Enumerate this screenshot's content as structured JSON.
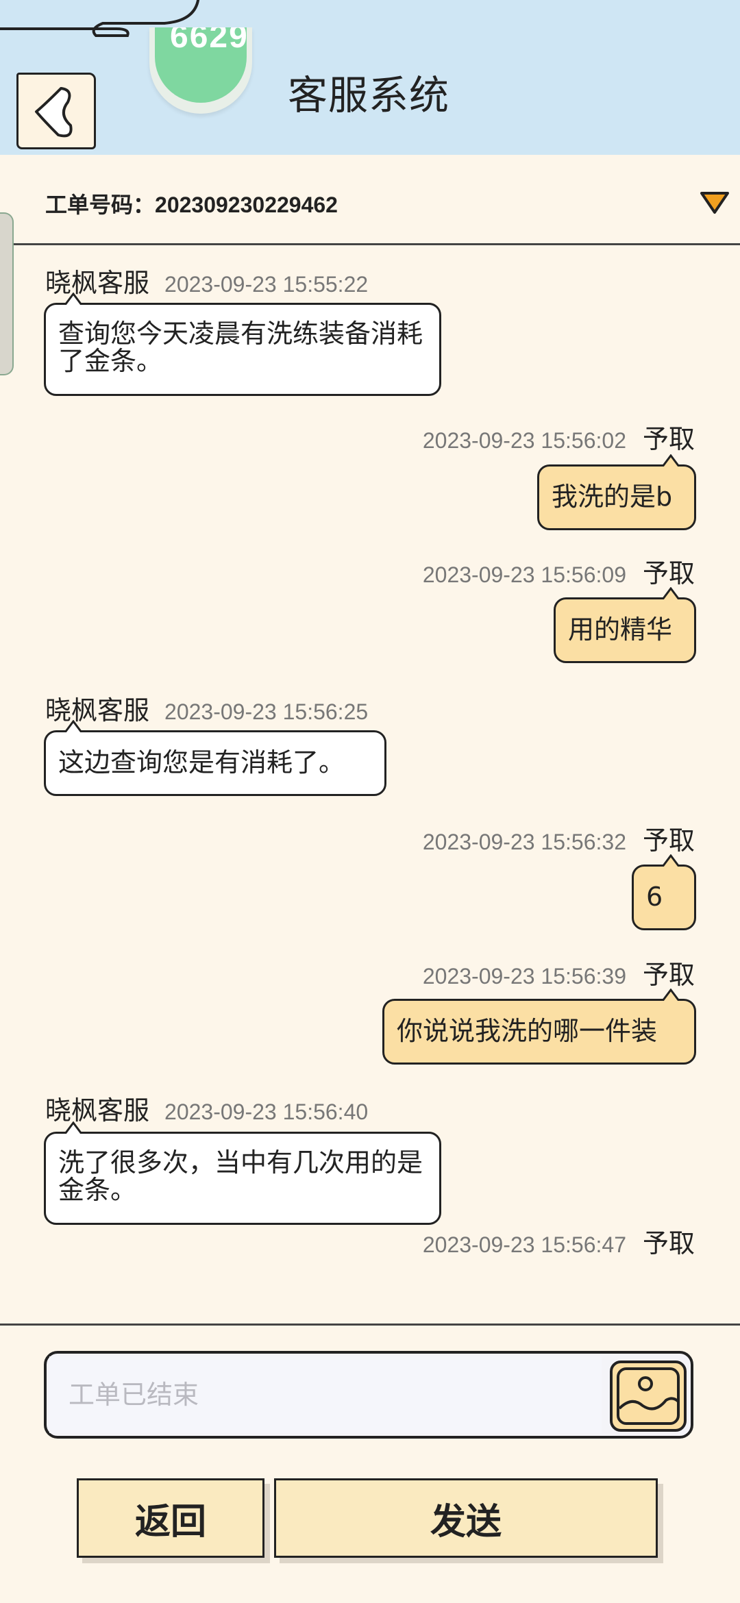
{
  "header": {
    "title": "客服系统",
    "avatar_text": "6629"
  },
  "ticket": {
    "label": "工单号码：",
    "number": "202309230229462"
  },
  "messages": [
    {
      "side": "left",
      "sender": "晓枫客服",
      "time": "2023-09-23 15:55:22",
      "text": "查询您今天凌晨有洗练装备消耗了金条。"
    },
    {
      "side": "right",
      "sender": "予取",
      "time": "2023-09-23 15:56:02",
      "text": "我洗的是b"
    },
    {
      "side": "right",
      "sender": "予取",
      "time": "2023-09-23 15:56:09",
      "text": "用的精华"
    },
    {
      "side": "left",
      "sender": "晓枫客服",
      "time": "2023-09-23 15:56:25",
      "text": "这边查询您是有消耗了。"
    },
    {
      "side": "right",
      "sender": "予取",
      "time": "2023-09-23 15:56:32",
      "text": "6"
    },
    {
      "side": "right",
      "sender": "予取",
      "time": "2023-09-23 15:56:39",
      "text": "你说说我洗的哪一件装"
    },
    {
      "side": "left",
      "sender": "晓枫客服",
      "time": "2023-09-23 15:56:40",
      "text": "洗了很多次，当中有几次用的是金条。"
    },
    {
      "side": "right",
      "sender": "予取",
      "time": "2023-09-23 15:56:47",
      "text": ""
    }
  ],
  "input": {
    "placeholder": "工单已结束"
  },
  "buttons": {
    "back": "返回",
    "send": "发送"
  },
  "colors": {
    "header_bg": "#cfe6f4",
    "page_bg": "#fdf6ea",
    "bubble_mine": "#fbdfa4",
    "bubble_other": "#ffffff",
    "accent_orange": "#f0a020"
  }
}
